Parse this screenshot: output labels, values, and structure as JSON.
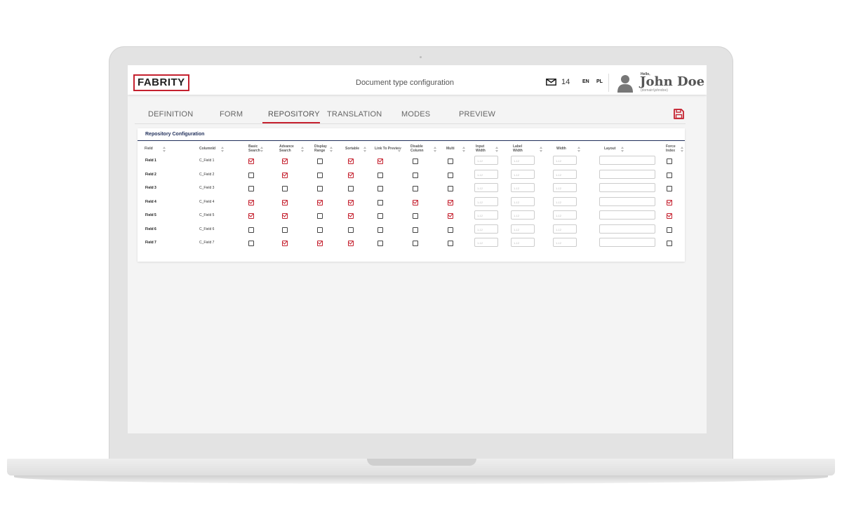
{
  "header": {
    "logo": "FABRITY",
    "page_title": "Document type configuration",
    "mail_count": "14",
    "languages": [
      "EN",
      "PL"
    ],
    "greeting": "Hello,",
    "user_name": "John Doe",
    "user_domain": "(domain\\johndoe)"
  },
  "tabs": [
    {
      "label": "DEFINITION",
      "active": false
    },
    {
      "label": "FORM",
      "active": false
    },
    {
      "label": "REPOSITORY",
      "active": true
    },
    {
      "label": "TRANSLATION",
      "active": false
    },
    {
      "label": "MODES",
      "active": false
    },
    {
      "label": "PREVIEW",
      "active": false
    }
  ],
  "panel": {
    "title": "Repository Configuration",
    "columns": [
      {
        "label": "Field"
      },
      {
        "label": "ColumnId"
      },
      {
        "label": "Basic Search"
      },
      {
        "label": "Advance Search"
      },
      {
        "label": "Display Range"
      },
      {
        "label": "Sortable"
      },
      {
        "label": "Link To Preview"
      },
      {
        "label": "Disable Column"
      },
      {
        "label": "Multi"
      },
      {
        "label": "Input Width"
      },
      {
        "label": "Label Width"
      },
      {
        "label": "Width"
      },
      {
        "label": "Layout"
      },
      {
        "label": "Force Index"
      }
    ],
    "input_placeholder": "1-12",
    "rows": [
      {
        "field": "Field 1",
        "column_id": "C_Field 1",
        "basic": true,
        "advance": true,
        "range": false,
        "sortable": true,
        "link": true,
        "disable": false,
        "multi": false,
        "force": false
      },
      {
        "field": "Field 2",
        "column_id": "C_Field 2",
        "basic": false,
        "advance": true,
        "range": false,
        "sortable": true,
        "link": false,
        "disable": false,
        "multi": false,
        "force": false
      },
      {
        "field": "Field 3",
        "column_id": "C_Field 3",
        "basic": false,
        "advance": false,
        "range": false,
        "sortable": false,
        "link": false,
        "disable": false,
        "multi": false,
        "force": false
      },
      {
        "field": "Field 4",
        "column_id": "C_Field 4",
        "basic": true,
        "advance": true,
        "range": true,
        "sortable": true,
        "link": false,
        "disable": true,
        "multi": true,
        "force": true
      },
      {
        "field": "Field 5",
        "column_id": "C_Field 5",
        "basic": true,
        "advance": true,
        "range": false,
        "sortable": true,
        "link": false,
        "disable": false,
        "multi": true,
        "force": true
      },
      {
        "field": "Field 6",
        "column_id": "C_Field 6",
        "basic": false,
        "advance": false,
        "range": false,
        "sortable": false,
        "link": false,
        "disable": false,
        "multi": false,
        "force": false
      },
      {
        "field": "Field 7",
        "column_id": "C_Field 7",
        "basic": false,
        "advance": true,
        "range": true,
        "sortable": true,
        "link": false,
        "disable": false,
        "multi": false,
        "force": false
      }
    ]
  },
  "colors": {
    "accent": "#c5212f",
    "title_blue": "#1f2e5a"
  },
  "icons": {
    "mail": "mail-icon",
    "user": "user-avatar-icon",
    "save": "save-icon",
    "sort": "sort-icon"
  }
}
